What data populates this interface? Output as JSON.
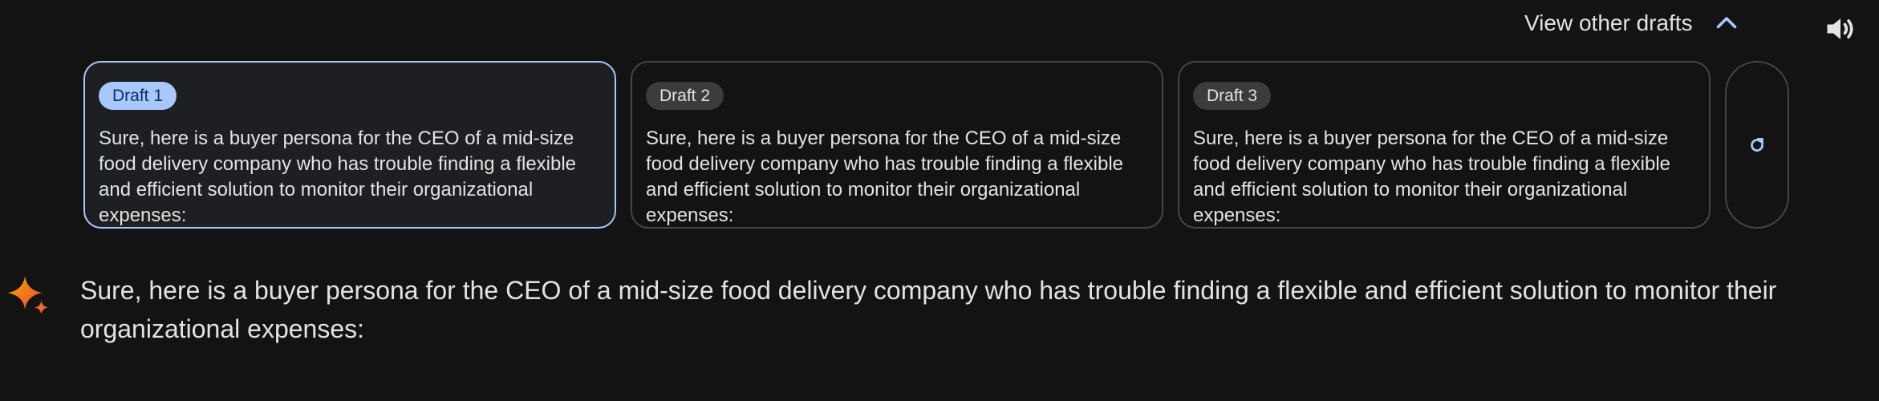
{
  "header": {
    "view_other_drafts_label": "View other drafts"
  },
  "drafts": [
    {
      "label": "Draft 1",
      "selected": true,
      "text": "Sure, here is a buyer persona for the CEO of a mid-size food delivery company who has trouble finding a flexible and efficient solution to monitor their organizational expenses:"
    },
    {
      "label": "Draft 2",
      "selected": false,
      "text": "Sure, here is a buyer persona for the CEO of a mid-size food delivery company who has trouble finding a flexible and efficient solution to monitor their organizational expenses:"
    },
    {
      "label": "Draft 3",
      "selected": false,
      "text": "Sure, here is a buyer persona for the CEO of a mid-size food delivery company who has trouble finding a flexible and efficient solution to monitor their organizational expenses:"
    }
  ],
  "response": {
    "text": "Sure, here is a buyer persona for the CEO of a mid-size food delivery company who has trouble finding a flexible and efficient solution to monitor their organizational expenses:"
  },
  "colors": {
    "background": "#131314",
    "selected_border": "#a8c7fa",
    "accent": "#a8c7fa"
  },
  "icons": {
    "collapse": "chevron-up-icon",
    "speaker": "speaker-icon",
    "regenerate": "refresh-icon",
    "assistant": "sparkle-icon"
  }
}
